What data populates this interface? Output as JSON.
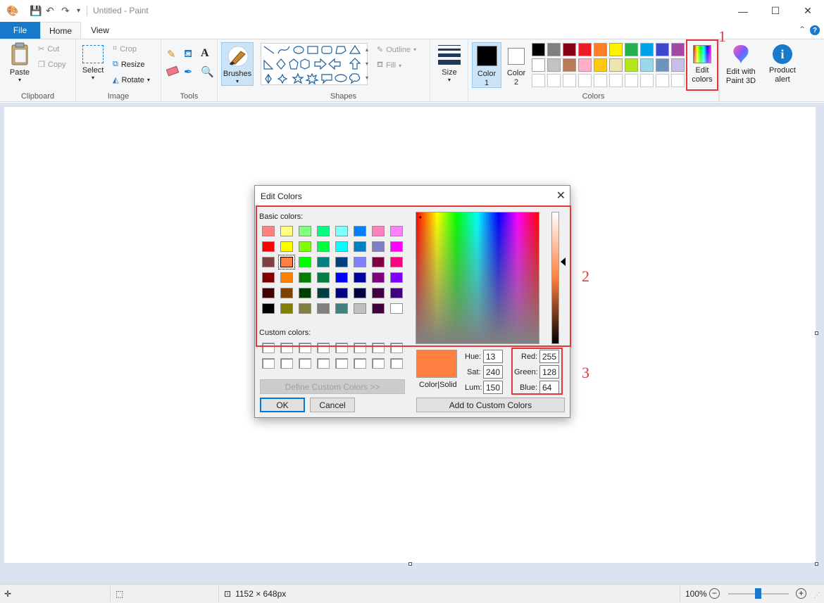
{
  "window": {
    "title": "Untitled - Paint",
    "minimize_glyph": "—",
    "maximize_glyph": "☐",
    "close_glyph": "✕"
  },
  "tabs": [
    {
      "label": "File"
    },
    {
      "label": "Home"
    },
    {
      "label": "View"
    }
  ],
  "ribbon": {
    "clipboard": {
      "label": "Clipboard",
      "paste": "Paste",
      "cut": "Cut",
      "copy": "Copy"
    },
    "image": {
      "label": "Image",
      "select": "Select",
      "crop": "Crop",
      "resize": "Resize",
      "rotate": "Rotate"
    },
    "tools": {
      "label": "Tools"
    },
    "brushes": {
      "label": "Brushes"
    },
    "shapes": {
      "label": "Shapes",
      "outline": "Outline",
      "fill": "Fill"
    },
    "size": {
      "label": "Size"
    },
    "colors": {
      "label": "Colors",
      "color1": "Color\n1",
      "color1_a": "Color",
      "color1_b": "1",
      "color2_a": "Color",
      "color2_b": "2",
      "edit_colors_a": "Edit",
      "edit_colors_b": "colors",
      "palette_row1": [
        "#000000",
        "#7f7f7f",
        "#880015",
        "#ed1c24",
        "#ff7f27",
        "#fff200",
        "#22b14c",
        "#00a2e8",
        "#3f48cc",
        "#a349a4"
      ],
      "palette_row2": [
        "#ffffff",
        "#c3c3c3",
        "#b97a57",
        "#ffaec9",
        "#ffc90e",
        "#efe4b0",
        "#b5e61d",
        "#99d9ea",
        "#7092be",
        "#c8bfe7"
      ]
    },
    "paint3d": {
      "line1": "Edit with",
      "line2": "Paint 3D"
    },
    "product_alert": {
      "line1": "Product",
      "line2": "alert"
    }
  },
  "status": {
    "canvas_size": "1152 × 648px",
    "zoom": "100%"
  },
  "dialog": {
    "title": "Edit Colors",
    "basic_colors_label": "Basic colors:",
    "custom_colors_label": "Custom colors:",
    "basic_colors": [
      [
        "#ff8080",
        "#ffff80",
        "#80ff80",
        "#00ff80",
        "#80ffff",
        "#0080ff",
        "#ff80c0",
        "#ff80ff"
      ],
      [
        "#ff0000",
        "#ffff00",
        "#80ff00",
        "#00ff40",
        "#00ffff",
        "#0080c0",
        "#8080c0",
        "#ff00ff"
      ],
      [
        "#804040",
        "#ff8040",
        "#00ff00",
        "#008080",
        "#004080",
        "#8080ff",
        "#800040",
        "#ff0080"
      ],
      [
        "#800000",
        "#ff8000",
        "#008000",
        "#008040",
        "#0000ff",
        "#0000a0",
        "#800080",
        "#8000ff"
      ],
      [
        "#400000",
        "#804000",
        "#004000",
        "#004040",
        "#000080",
        "#000040",
        "#400040",
        "#400080"
      ],
      [
        "#000000",
        "#808000",
        "#808040",
        "#808080",
        "#408080",
        "#c0c0c0",
        "#400040",
        "#ffffff"
      ]
    ],
    "define_custom": "Define Custom Colors >>",
    "ok": "OK",
    "cancel": "Cancel",
    "color_solid": "Color|Solid",
    "preview_color": "#ff8040",
    "hue_label": "Hue:",
    "hue": "13",
    "sat_label": "Sat:",
    "sat": "240",
    "lum_label": "Lum:",
    "lum": "150",
    "red_label": "Red:",
    "red": "255",
    "green_label": "Green:",
    "green": "128",
    "blue_label": "Blue:",
    "blue": "64",
    "add_custom": "Add to Custom Colors"
  },
  "annotations": {
    "n1": "1",
    "n2": "2",
    "n3": "3"
  },
  "accent_colors": {
    "file_tab": "#1979ca",
    "annotation": "#e0383b",
    "workspace": "#dae3ef"
  }
}
